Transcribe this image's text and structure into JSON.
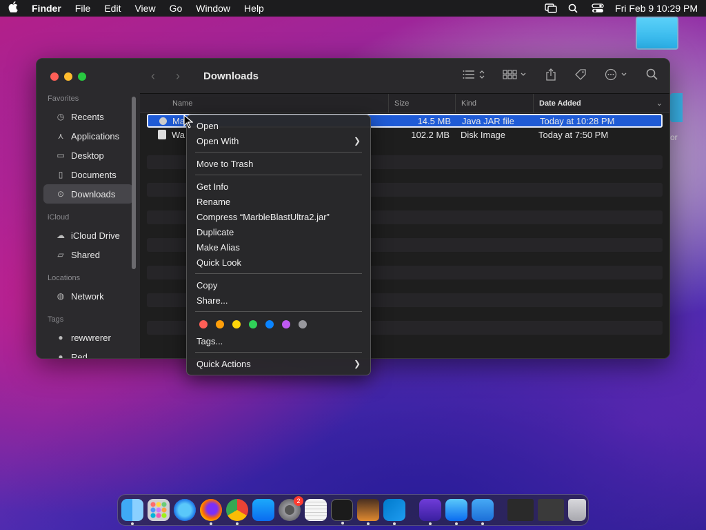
{
  "menubar": {
    "app": "Finder",
    "items": [
      "File",
      "Edit",
      "View",
      "Go",
      "Window",
      "Help"
    ],
    "clock": "Fri Feb 9  10:29 PM"
  },
  "desktop": {
    "partial_label": "or"
  },
  "sidebar": {
    "favorites_label": "Favorites",
    "favorites": [
      "Recents",
      "Applications",
      "Desktop",
      "Documents",
      "Downloads"
    ],
    "icloud_label": "iCloud",
    "icloud": [
      "iCloud Drive",
      "Shared"
    ],
    "locations_label": "Locations",
    "locations": [
      "Network"
    ],
    "tags_label": "Tags",
    "tags": [
      "rewwrerer",
      "Red"
    ]
  },
  "toolbar": {
    "title": "Downloads"
  },
  "columns": {
    "name": "Name",
    "size": "Size",
    "kind": "Kind",
    "date": "Date Added"
  },
  "files": [
    {
      "name": "Ma",
      "size": "14.5 MB",
      "kind": "Java JAR file",
      "date": "Today at 10:28 PM",
      "selected": true
    },
    {
      "name": "Wa",
      "size": "102.2 MB",
      "kind": "Disk Image",
      "date": "Today at 7:50 PM",
      "selected": false
    }
  ],
  "context_menu": {
    "open": "Open",
    "open_with": "Open With",
    "move_to_trash": "Move to Trash",
    "get_info": "Get Info",
    "rename": "Rename",
    "compress": "Compress “MarbleBlastUltra2.jar”",
    "duplicate": "Duplicate",
    "make_alias": "Make Alias",
    "quick_look": "Quick Look",
    "copy": "Copy",
    "share": "Share...",
    "tags": "Tags...",
    "quick_actions": "Quick Actions",
    "tag_colors": [
      "#ff5f57",
      "#ff9f0a",
      "#ffd60a",
      "#30d158",
      "#0a84ff",
      "#bf5af2",
      "#98989d"
    ]
  },
  "dock": {
    "settings_badge": "2"
  }
}
